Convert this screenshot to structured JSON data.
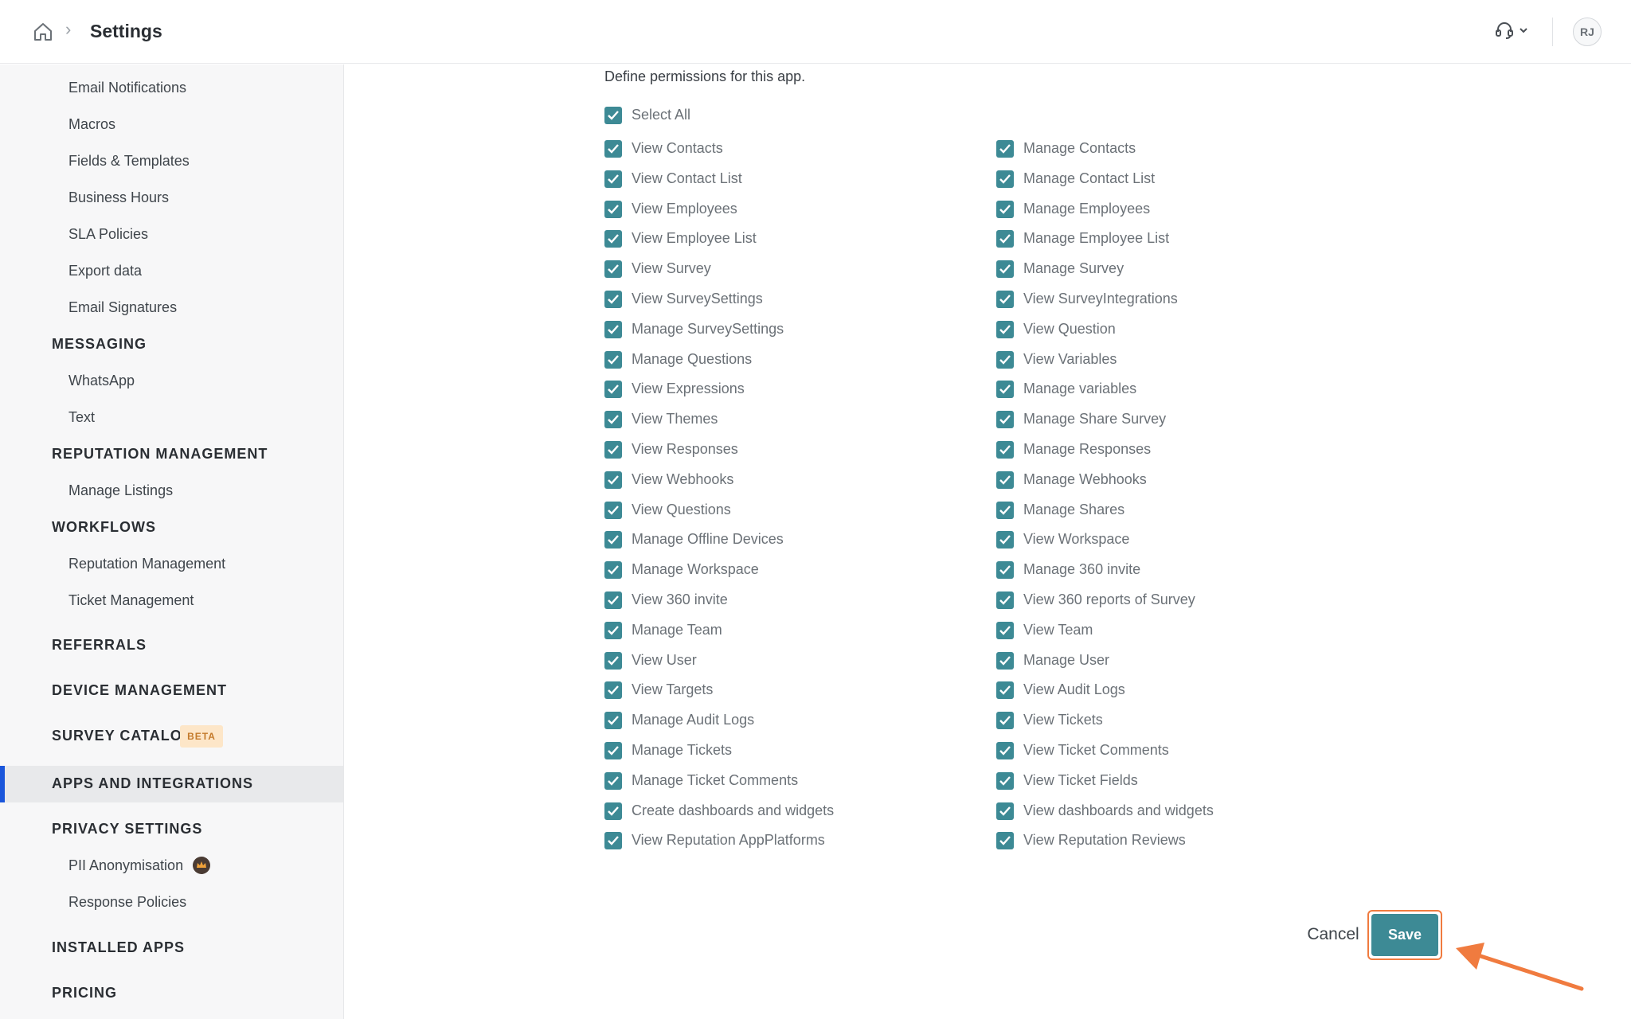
{
  "header": {
    "title": "Settings",
    "separator": "›",
    "avatar_initials": "RJ"
  },
  "sidebar": {
    "items": [
      {
        "label": "Email Notifications",
        "type": "sub"
      },
      {
        "label": "Macros",
        "type": "sub"
      },
      {
        "label": "Fields & Templates",
        "type": "sub"
      },
      {
        "label": "Business Hours",
        "type": "sub"
      },
      {
        "label": "SLA Policies",
        "type": "sub"
      },
      {
        "label": "Export data",
        "type": "sub"
      },
      {
        "label": "Email Signatures",
        "type": "sub"
      },
      {
        "label": "MESSAGING",
        "type": "head"
      },
      {
        "label": "WhatsApp",
        "type": "sub"
      },
      {
        "label": "Text",
        "type": "sub"
      },
      {
        "label": "REPUTATION MANAGEMENT",
        "type": "head"
      },
      {
        "label": "Manage Listings",
        "type": "sub"
      },
      {
        "label": "WORKFLOWS",
        "type": "head"
      },
      {
        "label": "Reputation Management",
        "type": "sub"
      },
      {
        "label": "Ticket Management",
        "type": "sub"
      },
      {
        "label": "REFERRALS",
        "type": "head"
      },
      {
        "label": "DEVICE MANAGEMENT",
        "type": "head"
      },
      {
        "label": "SURVEY CATALOG",
        "type": "head",
        "badge": "BETA"
      },
      {
        "label": "APPS AND INTEGRATIONS",
        "type": "head",
        "active": true
      },
      {
        "label": "PRIVACY SETTINGS",
        "type": "head"
      },
      {
        "label": "PII Anonymisation",
        "type": "sub",
        "icon": "crown-icon"
      },
      {
        "label": "Response Policies",
        "type": "sub"
      },
      {
        "label": "INSTALLED APPS",
        "type": "head"
      },
      {
        "label": "PRICING",
        "type": "head"
      }
    ]
  },
  "permissions": {
    "intro": "Define permissions for this app.",
    "select_all": {
      "label": "Select All",
      "checked": true
    },
    "left": [
      {
        "label": "View Contacts",
        "checked": true
      },
      {
        "label": "View Contact List",
        "checked": true
      },
      {
        "label": "View Employees",
        "checked": true
      },
      {
        "label": "View Employee List",
        "checked": true
      },
      {
        "label": "View Survey",
        "checked": true
      },
      {
        "label": "View SurveySettings",
        "checked": true
      },
      {
        "label": "Manage SurveySettings",
        "checked": true
      },
      {
        "label": "Manage Questions",
        "checked": true
      },
      {
        "label": "View Expressions",
        "checked": true
      },
      {
        "label": "View Themes",
        "checked": true
      },
      {
        "label": "View Responses",
        "checked": true
      },
      {
        "label": "View Webhooks",
        "checked": true
      },
      {
        "label": "View Questions",
        "checked": true
      },
      {
        "label": "Manage Offline Devices",
        "checked": true
      },
      {
        "label": "Manage Workspace",
        "checked": true
      },
      {
        "label": "View 360 invite",
        "checked": true
      },
      {
        "label": "Manage Team",
        "checked": true
      },
      {
        "label": "View User",
        "checked": true
      },
      {
        "label": "View Targets",
        "checked": true
      },
      {
        "label": "Manage Audit Logs",
        "checked": true
      },
      {
        "label": "Manage Tickets",
        "checked": true
      },
      {
        "label": "Manage Ticket Comments",
        "checked": true
      },
      {
        "label": "Create dashboards and widgets",
        "checked": true
      },
      {
        "label": "View Reputation AppPlatforms",
        "checked": true
      }
    ],
    "right": [
      {
        "label": "Manage Contacts",
        "checked": true
      },
      {
        "label": "Manage Contact List",
        "checked": true
      },
      {
        "label": "Manage Employees",
        "checked": true
      },
      {
        "label": "Manage Employee List",
        "checked": true
      },
      {
        "label": "Manage Survey",
        "checked": true
      },
      {
        "label": "View SurveyIntegrations",
        "checked": true
      },
      {
        "label": "View Question",
        "checked": true
      },
      {
        "label": "View Variables",
        "checked": true
      },
      {
        "label": "Manage variables",
        "checked": true
      },
      {
        "label": "Manage Share Survey",
        "checked": true
      },
      {
        "label": "Manage Responses",
        "checked": true
      },
      {
        "label": "Manage Webhooks",
        "checked": true
      },
      {
        "label": "Manage Shares",
        "checked": true
      },
      {
        "label": "View Workspace",
        "checked": true
      },
      {
        "label": "Manage 360 invite",
        "checked": true
      },
      {
        "label": "View 360 reports of Survey",
        "checked": true
      },
      {
        "label": "View Team",
        "checked": true
      },
      {
        "label": "Manage User",
        "checked": true
      },
      {
        "label": "View Audit Logs",
        "checked": true
      },
      {
        "label": "View Tickets",
        "checked": true
      },
      {
        "label": "View Ticket Comments",
        "checked": true
      },
      {
        "label": "View Ticket Fields",
        "checked": true
      },
      {
        "label": "View dashboards and widgets",
        "checked": true
      },
      {
        "label": "View Reputation Reviews",
        "checked": true
      }
    ]
  },
  "actions": {
    "cancel_label": "Cancel",
    "save_label": "Save"
  },
  "colors": {
    "accent": "#3d8a95",
    "active_indicator": "#1a56db",
    "highlight": "#f07b3f",
    "beta_bg": "#fde6c8"
  }
}
